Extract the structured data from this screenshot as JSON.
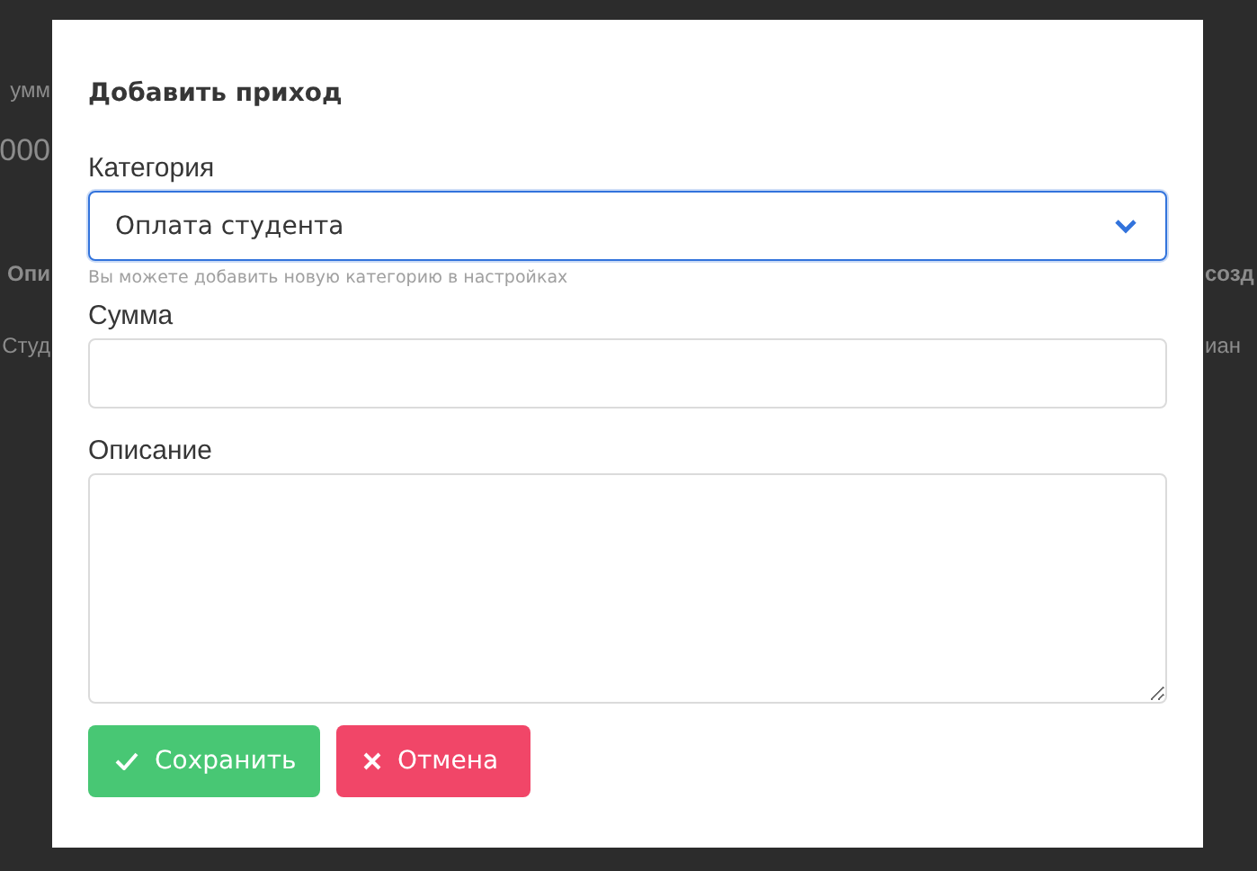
{
  "background": {
    "left": [
      {
        "kind": "label",
        "text": "умм"
      },
      {
        "kind": "amount",
        "text": "000"
      },
      {
        "kind": "heading",
        "text": "Опи"
      },
      {
        "kind": "cell",
        "text": "Студ"
      }
    ],
    "right": [
      {
        "kind": "heading",
        "text": "созд"
      },
      {
        "kind": "cell",
        "text": "иан"
      }
    ]
  },
  "dialog": {
    "title": "Добавить приход",
    "fields": [
      {
        "kind": "select",
        "label": "Категория",
        "value": "Оплата студента",
        "focused": true,
        "hint": "Вы можете добавить новую категорию в настройках"
      },
      {
        "kind": "input",
        "label": "Сумма",
        "focused": false
      },
      {
        "kind": "textarea",
        "label": "Описание",
        "focused": false
      }
    ],
    "buttons": [
      {
        "kind": "confirm",
        "label": "Сохранить"
      },
      {
        "kind": "cancel",
        "label": "Отмена"
      }
    ]
  }
}
